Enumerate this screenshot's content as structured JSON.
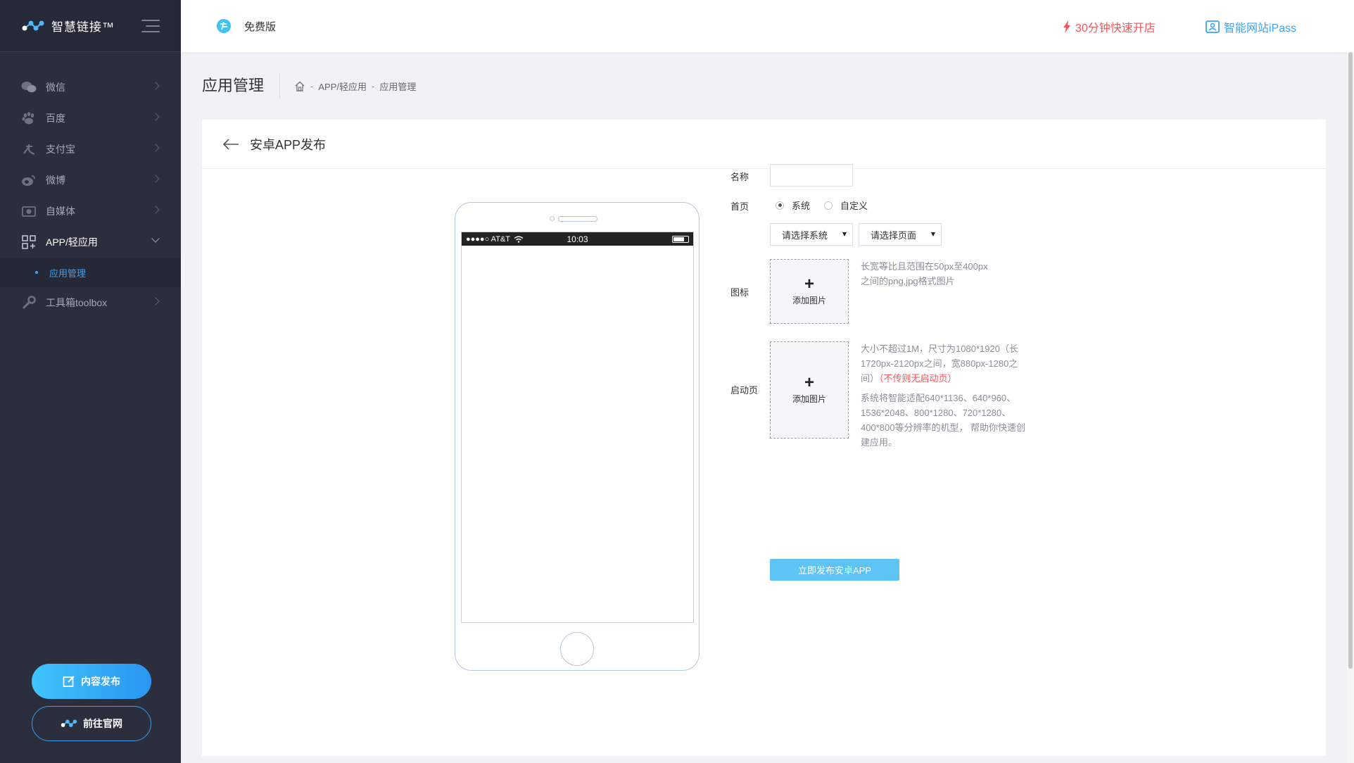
{
  "brand": {
    "name": "智慧链接™"
  },
  "sidebar": {
    "items": [
      {
        "label": "微信"
      },
      {
        "label": "百度"
      },
      {
        "label": "支付宝"
      },
      {
        "label": "微博"
      },
      {
        "label": "自媒体"
      },
      {
        "label": "APP/轻应用"
      },
      {
        "label": "工具箱toolbox"
      }
    ],
    "sub_item": "应用管理",
    "publish_button": "内容发布",
    "site_button": "前往官网"
  },
  "topbar": {
    "version": "免费版",
    "promo": "30分钟快速开店",
    "ipass": "智能网站iPass"
  },
  "page": {
    "title": "应用管理",
    "breadcrumb": [
      "APP/轻应用",
      "应用管理"
    ],
    "separator": "-"
  },
  "card": {
    "title": "安卓APP发布"
  },
  "phone": {
    "carrier": "●●●●○ AT&T",
    "time": "10:03"
  },
  "form": {
    "name_label": "名称",
    "name_value": "",
    "home_label": "首页",
    "radio_system": "系统",
    "radio_custom": "自定义",
    "select_system": "请选择系统",
    "select_page": "请选择页面",
    "icon_label": "图标",
    "upload_text": "添加图片",
    "icon_hint_1": "长宽等比且范围在50px至400px",
    "icon_hint_2": "之间的png,jpg格式图片",
    "splash_label": "启动页",
    "splash_hint_1": "大小不超过1M，尺寸为1080*1920（长",
    "splash_hint_2": "1720px-2120px之间，宽880px-1280之",
    "splash_hint_3": "间）",
    "splash_warn": "（不传则无启动页）",
    "splash_hint_4": "系统将智能适配640*1136、640*960、",
    "splash_hint_5": "1536*2048、800*1280、720*1280、",
    "splash_hint_6": "400*800等分辨率的机型， 帮助你快速创",
    "splash_hint_7": "建应用。",
    "submit": "立即发布安卓APP"
  },
  "colors": {
    "sidebar_bg": "#2b2e3d",
    "accent": "#3ba3f8",
    "promo": "#f3575b",
    "submit": "#5ec4f6"
  }
}
